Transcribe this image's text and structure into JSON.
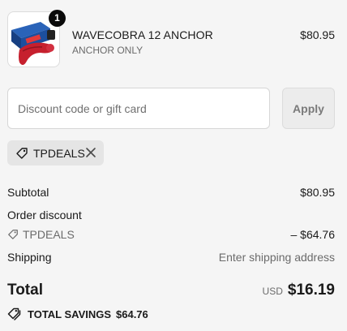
{
  "cart_item": {
    "quantity": "1",
    "name": "WAVECOBRA 12 ANCHOR",
    "variant": "ANCHOR ONLY",
    "price": "$80.95",
    "image_icon": "product-image-icon"
  },
  "discount": {
    "placeholder": "Discount code or gift card",
    "value": "",
    "apply_label": "Apply"
  },
  "applied_code": {
    "code": "TPDEALS",
    "tag_icon": "tag-icon",
    "remove_icon": "close-icon"
  },
  "summary": {
    "subtotal_label": "Subtotal",
    "subtotal_value": "$80.95",
    "order_discount_label": "Order discount",
    "discount_code": "TPDEALS",
    "discount_value": "– $64.76",
    "shipping_label": "Shipping",
    "shipping_value": "Enter shipping address"
  },
  "total": {
    "label": "Total",
    "currency": "USD",
    "amount": "$16.19"
  },
  "savings": {
    "label": "TOTAL SAVINGS",
    "amount": "$64.76",
    "icon": "tags-icon"
  },
  "colors": {
    "background": "#f5f5f5",
    "chip_background": "#e5e5e5",
    "badge": "#0a0a0a",
    "product_red": "#c6202e",
    "product_box_blue": "#1c4f9e"
  }
}
